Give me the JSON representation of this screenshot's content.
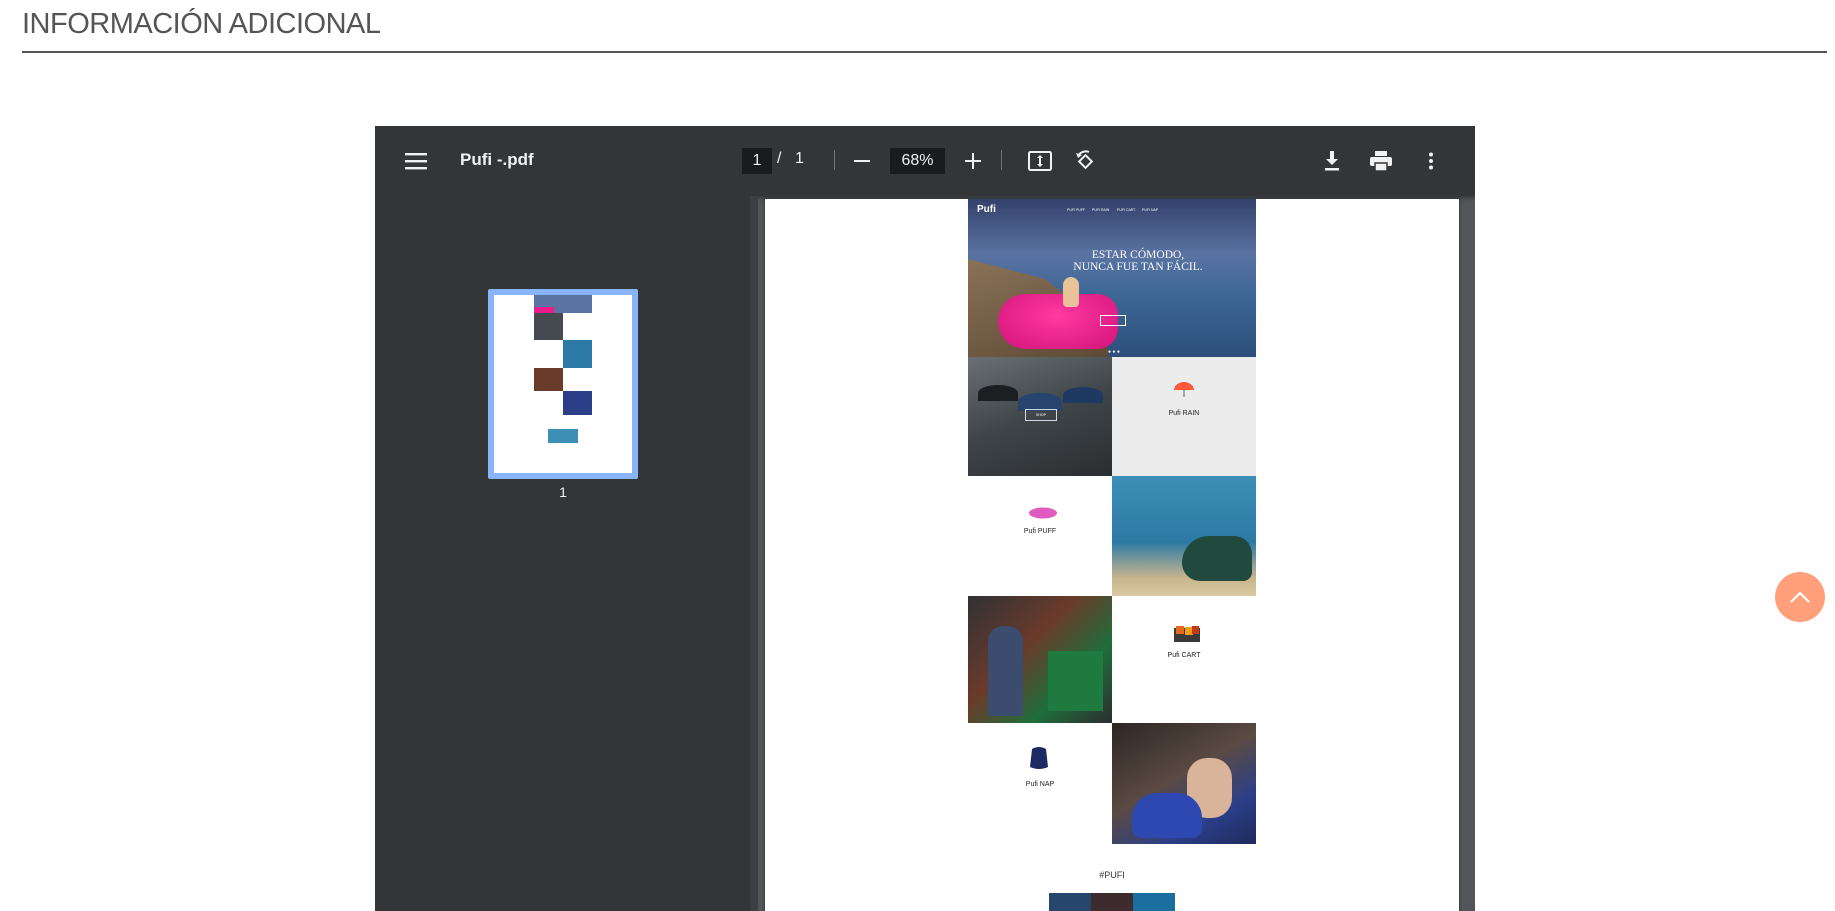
{
  "section": {
    "title": "INFORMACIÓN ADICIONAL"
  },
  "viewer": {
    "doc_title": "Pufi -.pdf",
    "current_page": "1",
    "page_sep": "/",
    "total_pages": "1",
    "zoom": "68%",
    "thumbnail_label": "1",
    "icons": [
      "menu-icon",
      "zoom-out-icon",
      "zoom-in-icon",
      "fit-page-icon",
      "rotate-icon",
      "download-icon",
      "print-icon",
      "more-icon"
    ]
  },
  "pdf_page": {
    "hero": {
      "logo": "Pufi",
      "nav": [
        "PUFI PUFF",
        "PUFI RAIN",
        "PUFI CART",
        "PUFI NAP"
      ],
      "headline_line1": "ESTAR CÓMODO,",
      "headline_line2": "NUNCA FUE TAN FÁCIL."
    },
    "products": [
      {
        "name": "Pufi RAIN",
        "button": "SHOP"
      },
      {
        "name": "Pufi PUFF"
      },
      {
        "name": "Pufi CART"
      },
      {
        "name": "Pufi NAP"
      }
    ],
    "instagram": {
      "tag": "#PUFI"
    }
  },
  "colors": {
    "toolbar_bg": "#323639",
    "viewer_bg": "#525659",
    "thumb_highlight": "#8ab4f8",
    "scroll_top_bg": "#ffa07a",
    "hero_float": "#e91e8c"
  }
}
